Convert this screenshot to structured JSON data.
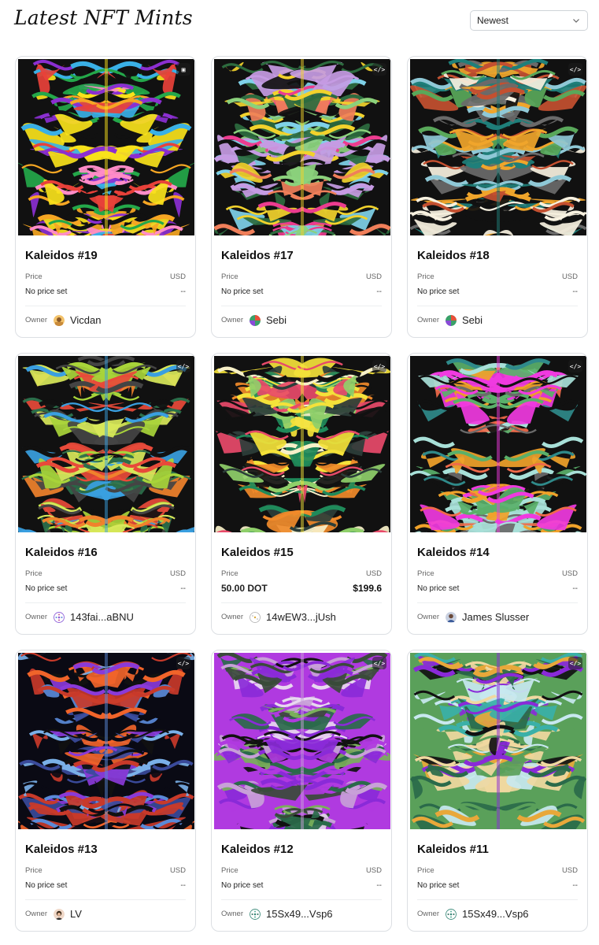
{
  "header": {
    "title": "Latest NFT Mints",
    "sort": {
      "selected": "Newest"
    }
  },
  "cards": [
    {
      "title": "Kaleidos #19",
      "price_label": "Price",
      "currency_label": "USD",
      "price": "No price set",
      "fiat": "--",
      "owner_label": "Owner",
      "owner": "Vicdan",
      "avatar": "avatar-vicdan",
      "media_icon": "image-icon",
      "palette": [
        "#e8413a",
        "#f9e21b",
        "#8b2fd1",
        "#f6a623",
        "#24a84a",
        "#3ab0e6",
        "#111111",
        "#ff8cc8"
      ]
    },
    {
      "title": "Kaleidos #17",
      "price_label": "Price",
      "currency_label": "USD",
      "price": "No price set",
      "fiat": "--",
      "owner_label": "Owner",
      "owner": "Sebi",
      "avatar": "avatar-sebi",
      "media_icon": "code-icon",
      "palette": [
        "#7fd1e8",
        "#f2d22c",
        "#f07f5a",
        "#c59be3",
        "#2d6b3f",
        "#ec3c8f",
        "#111111",
        "#8bd17c"
      ]
    },
    {
      "title": "Kaleidos #18",
      "price_label": "Price",
      "currency_label": "USD",
      "price": "No price set",
      "fiat": "--",
      "owner_label": "Owner",
      "owner": "Sebi",
      "avatar": "avatar-sebi",
      "media_icon": "code-icon",
      "palette": [
        "#f0a52b",
        "#1f7f7a",
        "#8fc8d6",
        "#f7f1e0",
        "#59a85a",
        "#c45030",
        "#111111",
        "#6a6a6a"
      ]
    },
    {
      "title": "Kaleidos #16",
      "price_label": "Price",
      "currency_label": "USD",
      "price": "No price set",
      "fiat": "--",
      "owner_label": "Owner",
      "owner": "143fai...aBNU",
      "avatar": "avatar-identicon",
      "media_icon": "code-icon",
      "palette": [
        "#a8d43a",
        "#3a9fe0",
        "#f0822c",
        "#444444",
        "#d8e85a",
        "#2b6e4a",
        "#111111",
        "#e84a3a"
      ]
    },
    {
      "title": "Kaleidos #15",
      "price_label": "Price",
      "currency_label": "USD",
      "price": "50.00 DOT",
      "fiat": "$199.6",
      "price_set": true,
      "owner_label": "Owner",
      "owner": "14wEW3...jUsh",
      "avatar": "avatar-identicon-light",
      "media_icon": "code-icon",
      "palette": [
        "#1f8a5a",
        "#f4e23a",
        "#f08a2a",
        "#e84a6a",
        "#2c3e3a",
        "#8fcf6a",
        "#111111",
        "#f7f0c8"
      ]
    },
    {
      "title": "Kaleidos #14",
      "price_label": "Price",
      "currency_label": "USD",
      "price": "No price set",
      "fiat": "--",
      "owner_label": "Owner",
      "owner": "James Slusser",
      "avatar": "avatar-james",
      "media_icon": "code-icon",
      "palette": [
        "#2f8a8a",
        "#f03ae0",
        "#f0a22a",
        "#6a6a6a",
        "#a8e0d8",
        "#f06a4a",
        "#111111",
        "#5ab06a"
      ]
    },
    {
      "title": "Kaleidos #13",
      "price_label": "Price",
      "currency_label": "USD",
      "price": "No price set",
      "fiat": "--",
      "owner_label": "Owner",
      "owner": "LV",
      "avatar": "avatar-lv",
      "media_icon": "code-icon",
      "palette": [
        "#111111",
        "#5a8ad8",
        "#f0642a",
        "#8a3ad8",
        "#7ab0e8",
        "#c83a2a",
        "#0a0a14",
        "#3a4a9a"
      ]
    },
    {
      "title": "Kaleidos #12",
      "price_label": "Price",
      "currency_label": "USD",
      "price": "No price set",
      "fiat": "--",
      "owner_label": "Owner",
      "owner": "15Sx49...Vsp6",
      "avatar": "avatar-identicon-teal",
      "media_icon": "code-icon",
      "palette": [
        "#8a2ad8",
        "#c8a0d8",
        "#2a6a4a",
        "#7ab05a",
        "#111111",
        "#e8d8f0",
        "#b03ae0",
        "#3a4a3a"
      ]
    },
    {
      "title": "Kaleidos #11",
      "price_label": "Price",
      "currency_label": "USD",
      "price": "No price set",
      "fiat": "--",
      "owner_label": "Owner",
      "owner": "15Sx49...Vsp6",
      "avatar": "avatar-identicon-teal",
      "media_icon": "code-icon",
      "palette": [
        "#3ab0a8",
        "#8a2ad8",
        "#f0d8a0",
        "#2a6a4a",
        "#111111",
        "#c8e8f0",
        "#5aa05a",
        "#e8a83a"
      ]
    }
  ]
}
